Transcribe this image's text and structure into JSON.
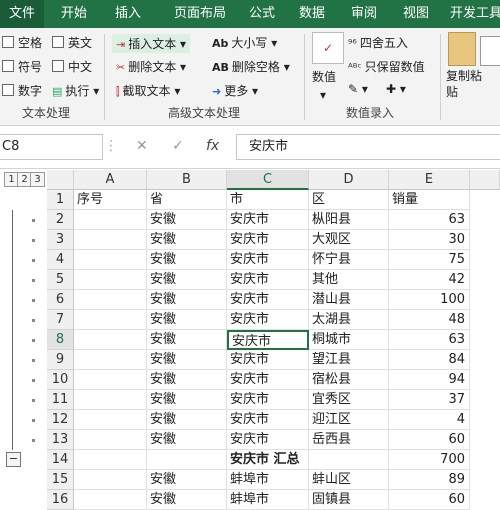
{
  "ribbon_tabs": [
    "文件",
    "开始",
    "插入",
    "页面布局",
    "公式",
    "数据",
    "审阅",
    "视图",
    "开发工具"
  ],
  "text_group": {
    "checkboxes": [
      "空格",
      "英文",
      "符号",
      "中文",
      "数字"
    ],
    "execute": "执行",
    "label": "文本处理"
  },
  "advanced_group": {
    "buttons": [
      "插入文本",
      "删除文本",
      "截取文本",
      "大小写",
      "删除空格",
      "更多"
    ],
    "label": "高级文本处理"
  },
  "number_group": {
    "numeric": "数值",
    "round": "四舍五入",
    "keep_numbers": "只保留数值",
    "label": "数值录入"
  },
  "paste": "复制粘贴",
  "name_box": "C8",
  "formula_value": "安庆市",
  "fx": "fx",
  "outline_levels": [
    "1",
    "2",
    "3"
  ],
  "columns": [
    "A",
    "B",
    "C",
    "D",
    "E"
  ],
  "rows": [
    {
      "num": "1",
      "a": "序号",
      "b": "省",
      "c": "市",
      "d": "区",
      "e": "销量"
    },
    {
      "num": "2",
      "a": "",
      "b": "安徽",
      "c": "安庆市",
      "d": "枞阳县",
      "e": "63"
    },
    {
      "num": "3",
      "a": "",
      "b": "安徽",
      "c": "安庆市",
      "d": "大观区",
      "e": "30"
    },
    {
      "num": "4",
      "a": "",
      "b": "安徽",
      "c": "安庆市",
      "d": "怀宁县",
      "e": "75"
    },
    {
      "num": "5",
      "a": "",
      "b": "安徽",
      "c": "安庆市",
      "d": "其他",
      "e": "42"
    },
    {
      "num": "6",
      "a": "",
      "b": "安徽",
      "c": "安庆市",
      "d": "潜山县",
      "e": "100"
    },
    {
      "num": "7",
      "a": "",
      "b": "安徽",
      "c": "安庆市",
      "d": "太湖县",
      "e": "48"
    },
    {
      "num": "8",
      "a": "",
      "b": "安徽",
      "c": "安庆市",
      "d": "桐城市",
      "e": "63"
    },
    {
      "num": "9",
      "a": "",
      "b": "安徽",
      "c": "安庆市",
      "d": "望江县",
      "e": "84"
    },
    {
      "num": "10",
      "a": "",
      "b": "安徽",
      "c": "安庆市",
      "d": "宿松县",
      "e": "94"
    },
    {
      "num": "11",
      "a": "",
      "b": "安徽",
      "c": "安庆市",
      "d": "宜秀区",
      "e": "37"
    },
    {
      "num": "12",
      "a": "",
      "b": "安徽",
      "c": "安庆市",
      "d": "迎江区",
      "e": "4"
    },
    {
      "num": "13",
      "a": "",
      "b": "安徽",
      "c": "安庆市",
      "d": "岳西县",
      "e": "60"
    },
    {
      "num": "14",
      "a": "",
      "b": "",
      "c": "安庆市 汇总",
      "d": "",
      "e": "700"
    },
    {
      "num": "15",
      "a": "",
      "b": "安徽",
      "c": "蚌埠市",
      "d": "蚌山区",
      "e": "89"
    },
    {
      "num": "16",
      "a": "",
      "b": "安徽",
      "c": "蚌埠市",
      "d": "固镇县",
      "e": "60"
    }
  ]
}
